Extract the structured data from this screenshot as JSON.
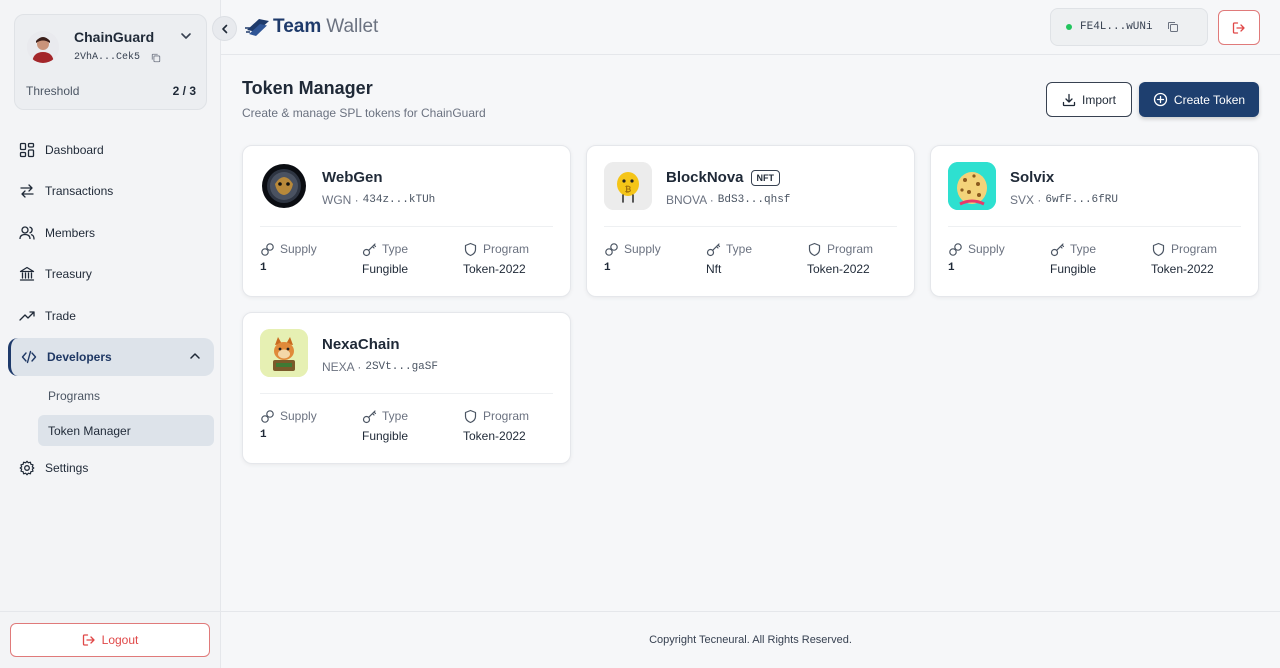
{
  "app": {
    "logo_team": "Team",
    "logo_wallet": "Wallet"
  },
  "vault": {
    "name": "ChainGuard",
    "address": "2VhA...Cek5",
    "threshold_label": "Threshold",
    "threshold_value": "2 / 3"
  },
  "nav": {
    "dashboard": "Dashboard",
    "transactions": "Transactions",
    "members": "Members",
    "treasury": "Treasury",
    "trade": "Trade",
    "developers": "Developers",
    "programs": "Programs",
    "token_manager": "Token Manager",
    "settings": "Settings",
    "logout": "Logout"
  },
  "header": {
    "wallet_address": "FE4L...wUNi"
  },
  "page": {
    "title": "Token Manager",
    "subtitle": "Create & manage SPL tokens for ChainGuard",
    "import_label": "Import",
    "create_label": "Create Token"
  },
  "labels": {
    "supply": "Supply",
    "type": "Type",
    "program": "Program"
  },
  "tokens": [
    {
      "name": "WebGen",
      "symbol": "WGN ·",
      "mint": "434z...kTUh",
      "supply": "1",
      "type": "Fungible",
      "program": "Token-2022",
      "badge": ""
    },
    {
      "name": "BlockNova",
      "symbol": "BNOVA ·",
      "mint": "BdS3...qhsf",
      "supply": "1",
      "type": "Nft",
      "program": "Token-2022",
      "badge": "NFT"
    },
    {
      "name": "Solvix",
      "symbol": "SVX ·",
      "mint": "6wfF...6fRU",
      "supply": "1",
      "type": "Fungible",
      "program": "Token-2022",
      "badge": ""
    },
    {
      "name": "NexaChain",
      "symbol": "NEXA ·",
      "mint": "2SVt...gaSF",
      "supply": "1",
      "type": "Fungible",
      "program": "Token-2022",
      "badge": ""
    }
  ],
  "footer": {
    "copyright": "Copyright Tecneural. All Rights Reserved."
  },
  "colors": {
    "primary": "#1e3f6f",
    "danger": "#e04848",
    "success": "#22c55e"
  }
}
